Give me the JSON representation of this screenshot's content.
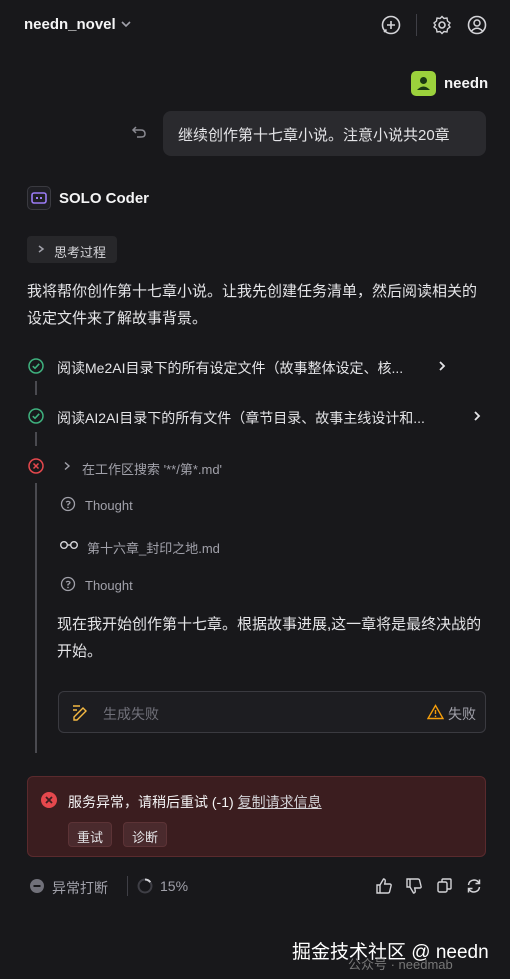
{
  "header": {
    "project_name": "needn_novel",
    "icons": [
      "new-chat-icon",
      "settings-icon",
      "account-icon"
    ]
  },
  "user": {
    "name": "needn",
    "message": "继续创作第十七章小说。注意小说共20章",
    "avatar_color": "#9bd13c"
  },
  "assistant": {
    "name": "SOLO Coder",
    "thinking_label": "思考过程",
    "intro_text": "我将帮你创作第十七章小说。让我先创建任务清单，然后阅读相关的设定文件来了解故事背景。",
    "steps": [
      {
        "status": "success",
        "text": "阅读Me2AI目录下的所有设定文件（故事整体设定、核..."
      },
      {
        "status": "success",
        "text": "阅读AI2AI目录下的所有文件（章节目录、故事主线设计和..."
      },
      {
        "status": "error",
        "text": "在工作区搜索 '**/第*.md'"
      }
    ],
    "substeps": [
      {
        "icon": "thought-icon",
        "text": "Thought"
      },
      {
        "icon": "glasses-icon",
        "text": "第十六章_封印之地.md"
      },
      {
        "icon": "thought-icon",
        "text": "Thought"
      }
    ],
    "continue_text": "现在我开始创作第十七章。根据故事进展,这一章将是最终决战的开始。",
    "generate": {
      "placeholder": "生成失败",
      "status": "失败"
    }
  },
  "error": {
    "message": "服务异常，请稍后重试 (-1)",
    "link": "复制请求信息",
    "retry": "重试",
    "diagnose": "诊断"
  },
  "footer": {
    "status": "异常打断",
    "progress": "15%",
    "progress_value": 0.15
  },
  "watermark": {
    "text": "掘金技术社区 @ needn",
    "sub": "公众号 · needmab"
  },
  "colors": {
    "success": "#3fb27f",
    "error": "#e5484d",
    "warning": "#f59e0b",
    "accent_pen": "#f5b942"
  }
}
